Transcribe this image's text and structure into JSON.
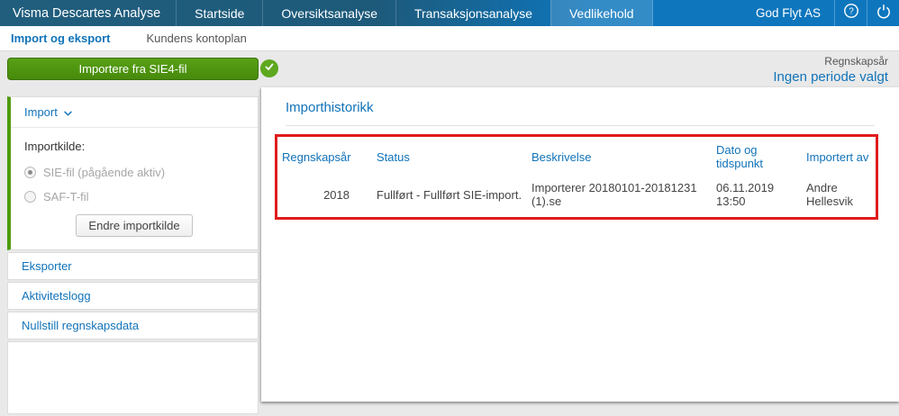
{
  "topnav": {
    "brand": "Visma Descartes Analyse",
    "items": [
      {
        "label": "Startside",
        "active": false
      },
      {
        "label": "Oversiktsanalyse",
        "active": false
      },
      {
        "label": "Transaksjonsanalyse",
        "active": false
      },
      {
        "label": "Vedlikehold",
        "active": true
      }
    ],
    "company": "God Flyt AS"
  },
  "subnav": {
    "items": [
      {
        "label": "Import og eksport",
        "active": true
      },
      {
        "label": "Kundens kontoplan",
        "active": false
      }
    ]
  },
  "toolbar": {
    "import_button_label": "Importere fra SIE4-fil",
    "fiscal_year_label": "Regnskapsår",
    "period_value": "Ingen periode valgt"
  },
  "sidebar": {
    "import": {
      "title": "Import",
      "source_label": "Importkilde:",
      "options": [
        {
          "label": "SIE-fil (pågående aktiv)",
          "selected": true
        },
        {
          "label": "SAF-T-fil",
          "selected": false
        }
      ],
      "change_button_label": "Endre importkilde"
    },
    "links": [
      "Eksporter",
      "Aktivitetslogg",
      "Nullstill regnskapsdata"
    ]
  },
  "main": {
    "title": "Importhistorikk",
    "table": {
      "headers": [
        "Regnskapsår",
        "Status",
        "Beskrivelse",
        "Dato og tidspunkt",
        "Importert av"
      ],
      "rows": [
        [
          "2018",
          "Fullført - Fullført SIE-import.",
          "Importerer 20180101-20181231 (1).se",
          "06.11.2019 13:50",
          "Andre Hellesvik"
        ]
      ]
    }
  },
  "colors": {
    "accent_blue": "#1173b9",
    "navbar_dark": "#1d5a7a",
    "navbar_bright": "#0d76bd",
    "button_green": "#4f9b0f",
    "success_green": "#5ea81f",
    "highlight_red": "#e01b1b",
    "page_background": "#e9e9e9"
  }
}
